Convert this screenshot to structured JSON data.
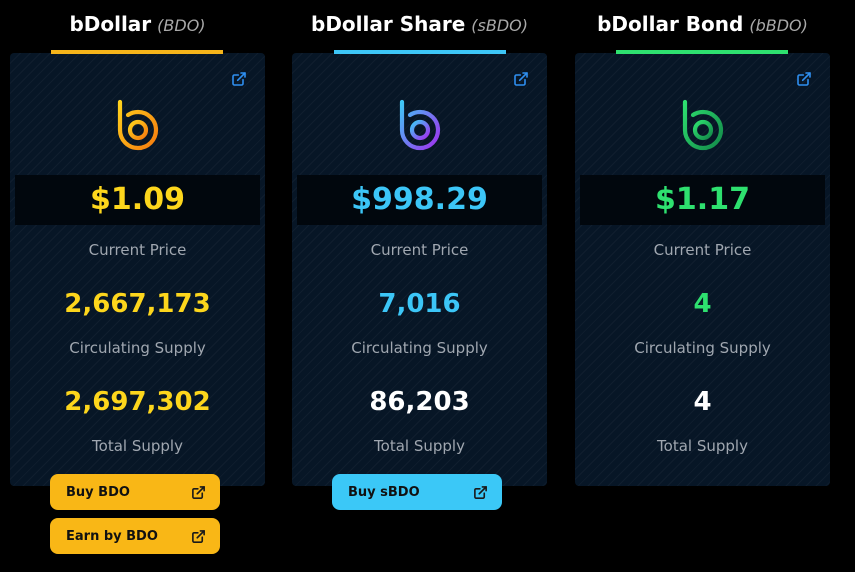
{
  "tokens": [
    {
      "name": "bDollar",
      "ticker": "(BDO)",
      "accent": "#f5b41a",
      "price": "$1.09",
      "price_label": "Current Price",
      "circulating": "2,667,173",
      "circulating_label": "Circulating Supply",
      "total": "2,697,302",
      "total_label": "Total Supply",
      "logo_icon": "bdollar-logo-icon",
      "link_icon": "external-link-icon"
    },
    {
      "name": "bDollar Share",
      "ticker": "(sBDO)",
      "accent": "#3dc6f7",
      "price": "$998.29",
      "price_label": "Current Price",
      "circulating": "7,016",
      "circulating_label": "Circulating Supply",
      "total": "86,203",
      "total_label": "Total Supply",
      "logo_icon": "bdollar-share-logo-icon",
      "link_icon": "external-link-icon"
    },
    {
      "name": "bDollar Bond",
      "ticker": "(bBDO)",
      "accent": "#2ee06f",
      "price": "$1.17",
      "price_label": "Current Price",
      "circulating": "4",
      "circulating_label": "Circulating Supply",
      "total": "4",
      "total_label": "Total Supply",
      "logo_icon": "bdollar-bond-logo-icon",
      "link_icon": "external-link-icon"
    }
  ],
  "buttons": {
    "buy_bdo": "Buy BDO",
    "earn_bdo": "Earn by BDO",
    "buy_sbdo": "Buy sBDO"
  },
  "colors": {
    "bdo_button": "#f9b716",
    "sbdo_button": "#3bc8f7",
    "link_icon": "#2f8ff0",
    "white_value": "#ffffff"
  }
}
